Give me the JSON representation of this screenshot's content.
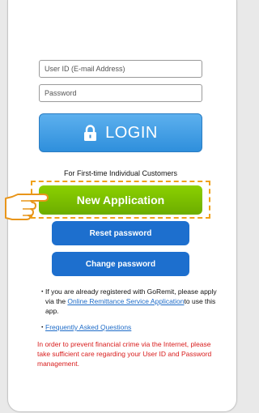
{
  "form": {
    "user_id_placeholder": "User ID (E-mail Address)",
    "password_placeholder": "Password",
    "login_label": "LOGIN"
  },
  "first_time": {
    "heading": "For First-time Individual Customers",
    "new_application_label": "New Application",
    "reset_password_label": "Reset password",
    "change_password_label": "Change password"
  },
  "info": {
    "bullet_char": "・",
    "registered_text_before": "If you are already registered with GoRemit, please apply via the ",
    "remittance_link": "Online Remittance Service Application",
    "registered_text_after": "to use this app.",
    "faq_link": "Frequently Asked Questions"
  },
  "warning": "In order to prevent financial crime via the Internet, please take sufficient care regarding your User ID and Password management.",
  "icons": {
    "login": "lock-icon",
    "pointer": "pointing-hand-icon"
  },
  "colors": {
    "login_button": "#3d9ae5",
    "new_application_button": "#7abc00",
    "secondary_button": "#1d6fce",
    "highlight_border": "#f0a21a",
    "link": "#1f6cc8",
    "warning_text": "#d81c1c"
  }
}
